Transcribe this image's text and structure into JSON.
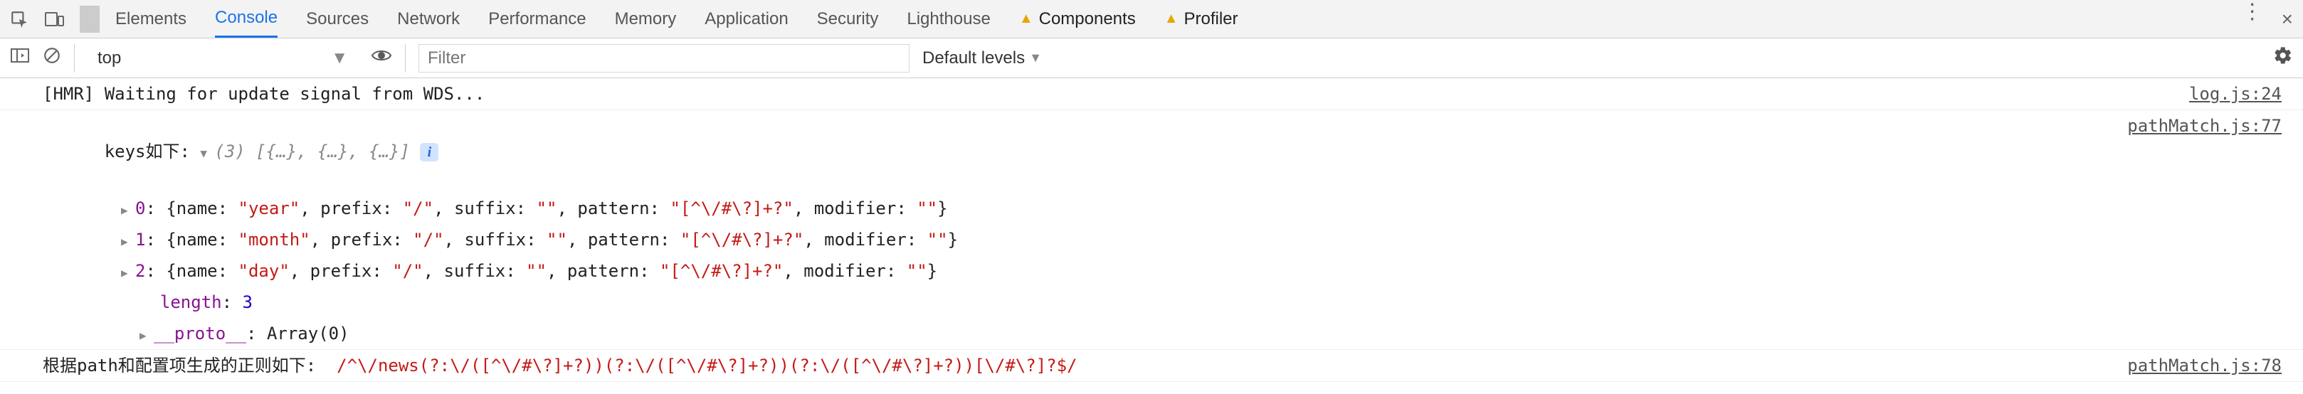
{
  "tabs": {
    "items": [
      "Elements",
      "Console",
      "Sources",
      "Network",
      "Performance",
      "Memory",
      "Application",
      "Security",
      "Lighthouse",
      "Components",
      "Profiler"
    ],
    "active_index": 1,
    "components_warning": true
  },
  "toolbar": {
    "context": "top",
    "filter_placeholder": "Filter",
    "levels_label": "Default levels"
  },
  "console": {
    "line1": {
      "text": "[HMR] Waiting for update signal from WDS...",
      "src": "log.js:24"
    },
    "line2": {
      "label": "keys如下: ",
      "summary_count": "(3)",
      "summary_body": "[{…}, {…}, {…}]",
      "src": "pathMatch.js:77"
    },
    "items": [
      {
        "idx": "0",
        "name": "year",
        "prefix": "/",
        "suffix": "",
        "pattern": "[^\\/#\\?]+?",
        "modifier": ""
      },
      {
        "idx": "1",
        "name": "month",
        "prefix": "/",
        "suffix": "",
        "pattern": "[^\\/#\\?]+?",
        "modifier": ""
      },
      {
        "idx": "2",
        "name": "day",
        "prefix": "/",
        "suffix": "",
        "pattern": "[^\\/#\\?]+?",
        "modifier": ""
      }
    ],
    "length_label": "length",
    "length_val": "3",
    "proto_label": "__proto__",
    "proto_val": "Array(0)",
    "line3": {
      "label": "根据path和配置项生成的正则如下:  ",
      "regex": "/^\\/news(?:\\/([^\\/#\\?]+?))(?:\\/([^\\/#\\?]+?))(?:\\/([^\\/#\\?]+?))[\\/#\\?]?$/",
      "src": "pathMatch.js:78"
    }
  }
}
